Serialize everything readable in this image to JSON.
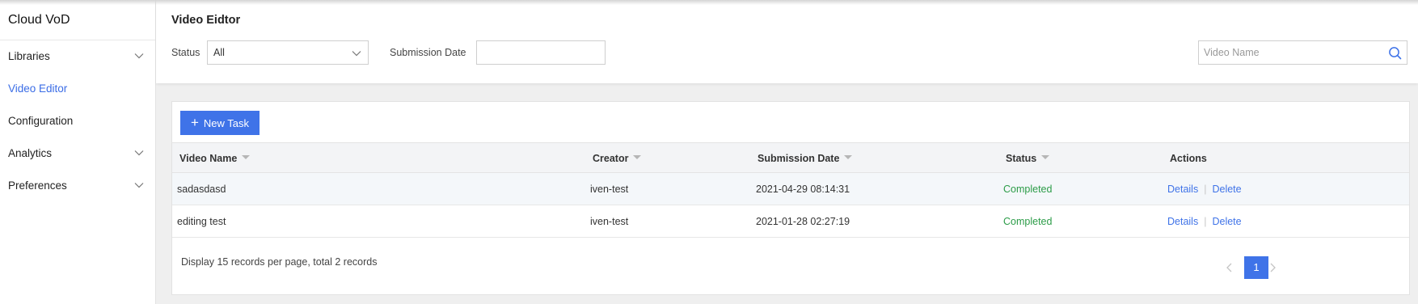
{
  "app": {
    "title": "Cloud VoD"
  },
  "sidebar": {
    "items": [
      {
        "label": "Libraries",
        "has_children": true,
        "active": false
      },
      {
        "label": "Video Editor",
        "has_children": false,
        "active": true
      },
      {
        "label": "Configuration",
        "has_children": false,
        "active": false
      },
      {
        "label": "Analytics",
        "has_children": true,
        "active": false
      },
      {
        "label": "Preferences",
        "has_children": true,
        "active": false
      }
    ]
  },
  "filter": {
    "page_title": "Video Eidtor",
    "status_label": "Status",
    "status_value": "All",
    "date_label": "Submission Date",
    "date_value": "",
    "search_placeholder": "Video Name"
  },
  "toolbar": {
    "new_task_label": "New Task"
  },
  "table": {
    "columns": [
      "Video Name",
      "Creator",
      "Submission Date",
      "Status",
      "Actions"
    ],
    "rows": [
      {
        "name": "sadasdasd",
        "creator": "iven-test",
        "date": "2021-04-29 08:14:31",
        "status": "Completed"
      },
      {
        "name": "editing test",
        "creator": "iven-test",
        "date": "2021-01-28 02:27:19",
        "status": "Completed"
      }
    ],
    "action_details": "Details",
    "action_delete": "Delete"
  },
  "pagination": {
    "summary": "Display 15 records per page, total 2 records",
    "current_page": "1"
  },
  "colors": {
    "accent": "#3f73e8",
    "status_completed": "#2c9c48",
    "active_nav": "#3b6de6"
  },
  "icons": [
    "chevron-down-icon",
    "search-icon",
    "plus-icon",
    "sort-caret-icon",
    "chevron-left-icon",
    "chevron-right-icon"
  ]
}
